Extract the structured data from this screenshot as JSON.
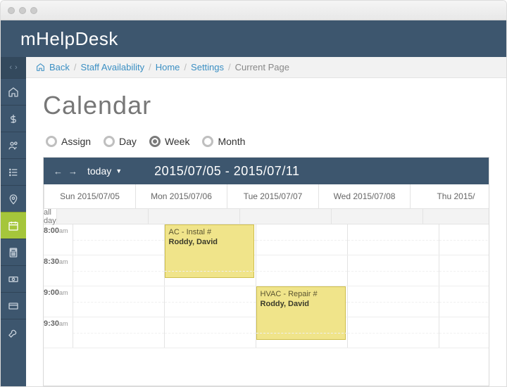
{
  "brand": "mHelpDesk",
  "breadcrumb": {
    "back": "Back",
    "items": [
      "Staff Availability",
      "Home",
      "Settings"
    ],
    "current": "Current Page"
  },
  "page_title": "Calendar",
  "view_toggles": {
    "assign": "Assign",
    "day": "Day",
    "week": "Week",
    "month": "Month",
    "selected": "week"
  },
  "cal_toolbar": {
    "today": "today",
    "range": "2015/07/05 - 2015/07/11"
  },
  "days": [
    {
      "label": "Sun 2015/07/05"
    },
    {
      "label": "Mon 2015/07/06"
    },
    {
      "label": "Tue 2015/07/07"
    },
    {
      "label": "Wed 2015/07/08"
    },
    {
      "label": "Thu 2015/"
    }
  ],
  "allday_label": "all day",
  "times": [
    {
      "h": "8:00",
      "ap": "am"
    },
    {
      "h": "8:30",
      "ap": "am"
    },
    {
      "h": "9:00",
      "ap": "am"
    },
    {
      "h": "9:30",
      "ap": "am"
    }
  ],
  "events": [
    {
      "day": 1,
      "slot": 0,
      "title": "AC - Instal #",
      "person": "Roddy, David"
    },
    {
      "day": 2,
      "slot": 2,
      "title": "HVAC - Repair #",
      "person": "Roddy, David"
    }
  ],
  "sidebar_icons": [
    "home",
    "dollar",
    "people",
    "list",
    "pin",
    "calendar",
    "calculator",
    "cash",
    "card",
    "wrench"
  ]
}
